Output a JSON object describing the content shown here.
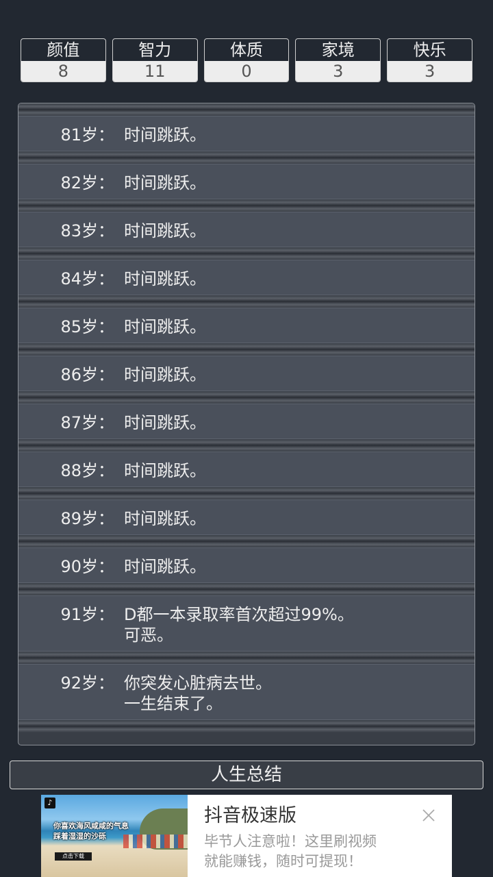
{
  "stats": [
    {
      "label": "颜值",
      "value": "8"
    },
    {
      "label": "智力",
      "value": "11"
    },
    {
      "label": "体质",
      "value": "0"
    },
    {
      "label": "家境",
      "value": "3"
    },
    {
      "label": "快乐",
      "value": "3"
    }
  ],
  "log": [
    {
      "age": "81岁：",
      "event": "时间跳跃。"
    },
    {
      "age": "82岁：",
      "event": "时间跳跃。"
    },
    {
      "age": "83岁：",
      "event": "时间跳跃。"
    },
    {
      "age": "84岁：",
      "event": "时间跳跃。"
    },
    {
      "age": "85岁：",
      "event": "时间跳跃。"
    },
    {
      "age": "86岁：",
      "event": "时间跳跃。"
    },
    {
      "age": "87岁：",
      "event": "时间跳跃。"
    },
    {
      "age": "88岁：",
      "event": "时间跳跃。"
    },
    {
      "age": "89岁：",
      "event": "时间跳跃。"
    },
    {
      "age": "90岁：",
      "event": "时间跳跃。"
    },
    {
      "age": "91岁：",
      "event": "D都一本录取率首次超过99%。\n可恶。"
    },
    {
      "age": "92岁：",
      "event": "你突发心脏病去世。\n一生结束了。"
    }
  ],
  "summary_button": "人生总结",
  "ad": {
    "app_name": "抖音极速版",
    "description": "毕节人注意啦！这里刷视频\n就能赚钱，随时可提现！",
    "image_caption_line1": "你喜欢海风咸咸的气息",
    "image_caption_line2": "踩着湿湿的沙砾",
    "image_cta": "点击下载",
    "logo_icon": "tiktok-logo-icon",
    "close_icon": "close-icon"
  }
}
